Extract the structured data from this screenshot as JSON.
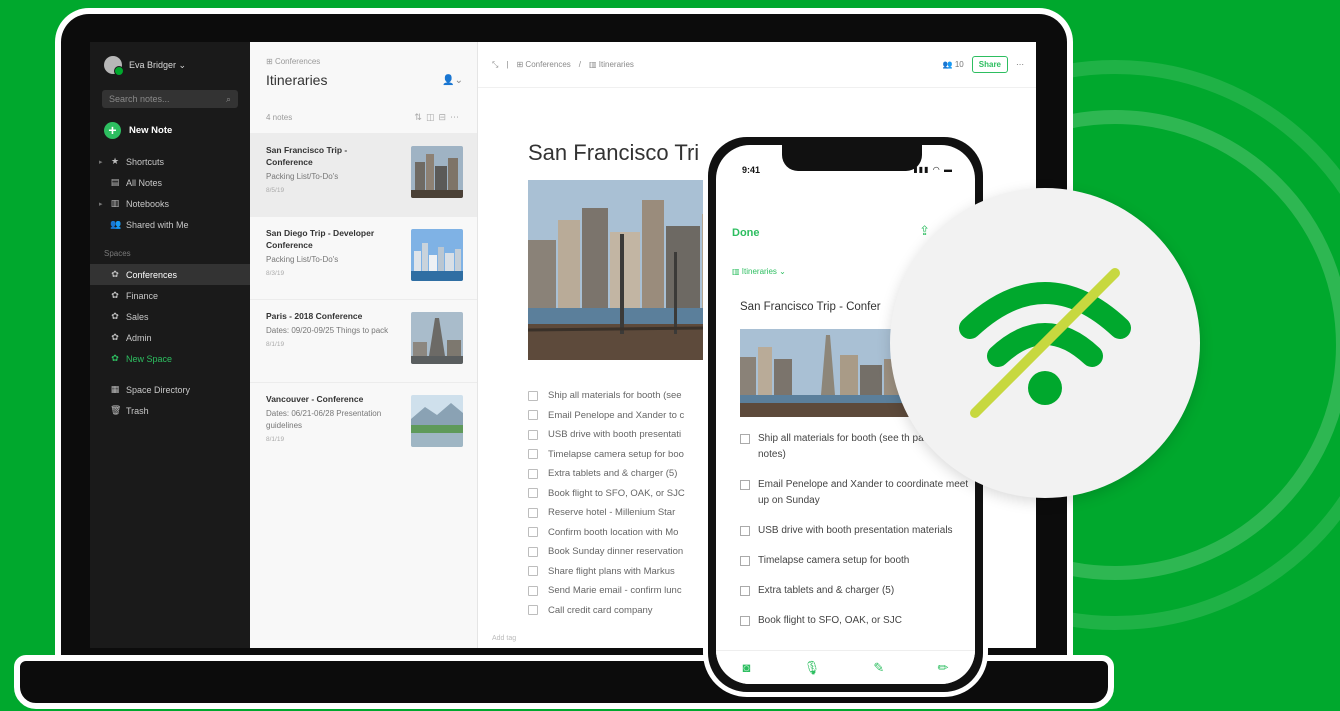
{
  "colors": {
    "background": "#00a82d",
    "accent": "#2dbe60",
    "sidebar_bg": "#1a1a1a",
    "offline_strike": "#c7d83f"
  },
  "sidebar": {
    "account_name": "Eva Bridger ⌄",
    "search_placeholder": "Search notes...",
    "new_note": "New Note",
    "items": [
      {
        "label": "Shortcuts",
        "icon": "star-icon"
      },
      {
        "label": "All Notes",
        "icon": "notes-icon"
      },
      {
        "label": "Notebooks",
        "icon": "notebook-icon"
      },
      {
        "label": "Shared with Me",
        "icon": "people-icon"
      }
    ],
    "spaces_header": "Spaces",
    "spaces": [
      {
        "label": "Conferences",
        "icon": "space-icon"
      },
      {
        "label": "Finance",
        "icon": "space-icon"
      },
      {
        "label": "Sales",
        "icon": "space-icon"
      },
      {
        "label": "Admin",
        "icon": "space-icon"
      },
      {
        "label": "New Space",
        "icon": "add-space-icon"
      }
    ],
    "footer_items": [
      {
        "label": "Space Directory",
        "icon": "directory-icon"
      },
      {
        "label": "Trash",
        "icon": "trash-icon"
      }
    ]
  },
  "notelist": {
    "breadcrumb": "Conferences",
    "title": "Itineraries",
    "count": "4 notes",
    "notes": [
      {
        "title": "San Francisco Trip - Conference",
        "snippet": "Packing List/To-Do's",
        "date": "8/5/19"
      },
      {
        "title": "San Diego Trip - Developer Conference",
        "snippet": "Packing List/To-Do's",
        "date": "8/3/19"
      },
      {
        "title": "Paris - 2018 Conference",
        "snippet": "Dates: 09/20-09/25 Things to pack",
        "date": "8/1/19"
      },
      {
        "title": "Vancouver - Conference",
        "snippet": "Dates: 06/21-06/28 Presentation guidelines",
        "date": "8/1/19"
      }
    ]
  },
  "editor": {
    "crumb_space": "Conferences",
    "crumb_notebook": "Itineraries",
    "members": "10",
    "share_label": "Share",
    "title": "San Francisco Tri",
    "checklist": [
      "Ship all materials for booth (see",
      "Email Penelope and Xander to c",
      "USB drive with booth presentati",
      "Timelapse camera setup for boo",
      "Extra tablets and & charger (5)",
      "Book flight to SFO, OAK, or SJC",
      "Reserve hotel - Millenium Star",
      "Confirm booth location with Mo",
      "Book Sunday dinner reservation",
      "Share flight plans with Markus",
      "Send Marie email - confirm lunc",
      "Call credit card company"
    ],
    "footer": "Add tag"
  },
  "phone": {
    "time": "9:41",
    "done_label": "Done",
    "breadcrumb": "Itineraries ⌄",
    "title": "San Francisco Trip - Confer",
    "checklist": [
      "Ship all materials for booth (see th packing notes)",
      "Email Penelope and Xander to coordinate meet up on Sunday",
      "USB drive with booth presentation materials",
      "Timelapse camera setup for booth",
      "Extra tablets and & charger (5)",
      "Book flight to SFO, OAK, or SJC"
    ]
  }
}
